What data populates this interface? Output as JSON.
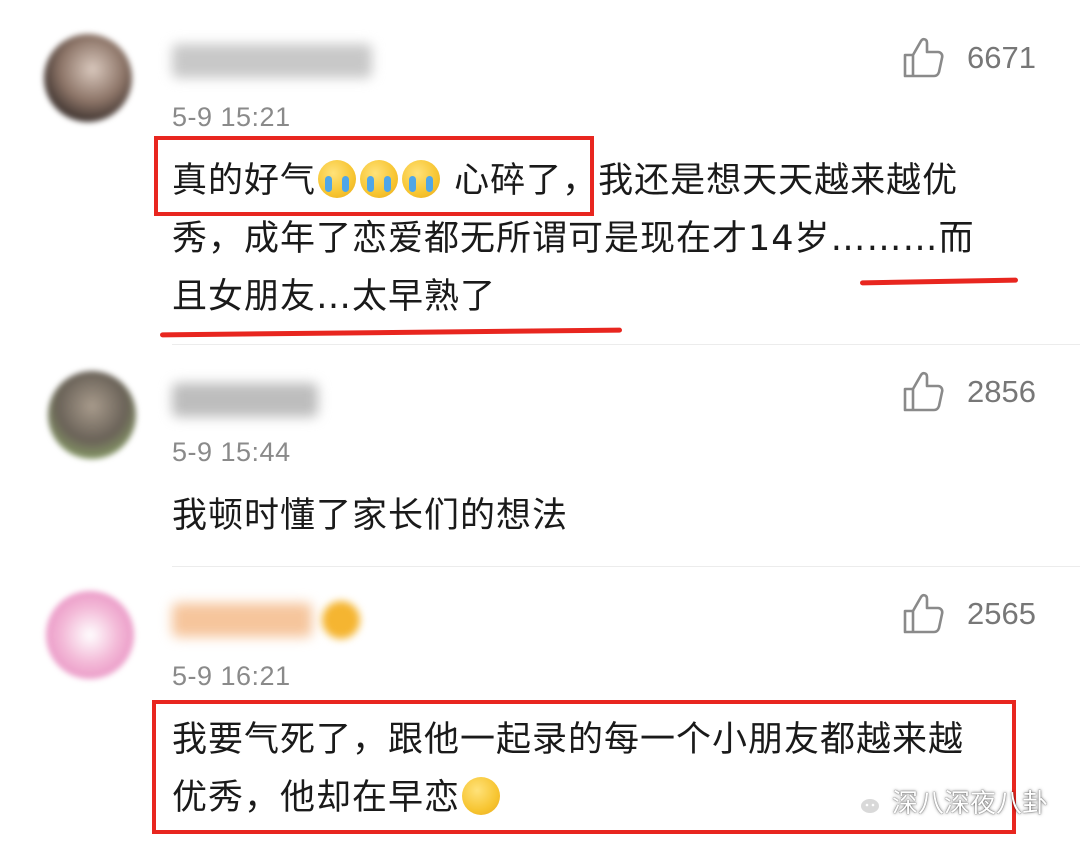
{
  "comments": [
    {
      "time": "5-9 15:21",
      "likes": "6671",
      "lines": [
        {
          "segments": [
            {
              "text": "真的好气"
            },
            {
              "emoji": "crying-face"
            },
            {
              "emoji": "crying-face"
            },
            {
              "emoji": "crying-face"
            },
            {
              "text": " 心碎了，我还是想天天越来越优"
            }
          ]
        },
        {
          "segments": [
            {
              "text": "秀，成年了恋爱都无所谓可是现在才14岁………而"
            }
          ]
        },
        {
          "segments": [
            {
              "text": "且女朋友…太早熟了"
            }
          ]
        }
      ]
    },
    {
      "time": "5-9 15:44",
      "likes": "2856",
      "lines": [
        {
          "segments": [
            {
              "text": "我顿时懂了家长们的想法"
            }
          ]
        }
      ]
    },
    {
      "time": "5-9 16:21",
      "likes": "2565",
      "lines": [
        {
          "segments": [
            {
              "text": "我要气死了，跟他一起录的每一个小朋友都越来越"
            }
          ]
        },
        {
          "segments": [
            {
              "text": "优秀，他却在早恋"
            },
            {
              "emoji": "sleepy-face"
            }
          ]
        }
      ]
    }
  ],
  "watermark": {
    "text": "深八深夜八卦",
    "icon": "wechat-icon"
  },
  "colors": {
    "highlight": "#e8261f",
    "meta_text": "#8a8a8a",
    "likes_text": "#777777"
  }
}
